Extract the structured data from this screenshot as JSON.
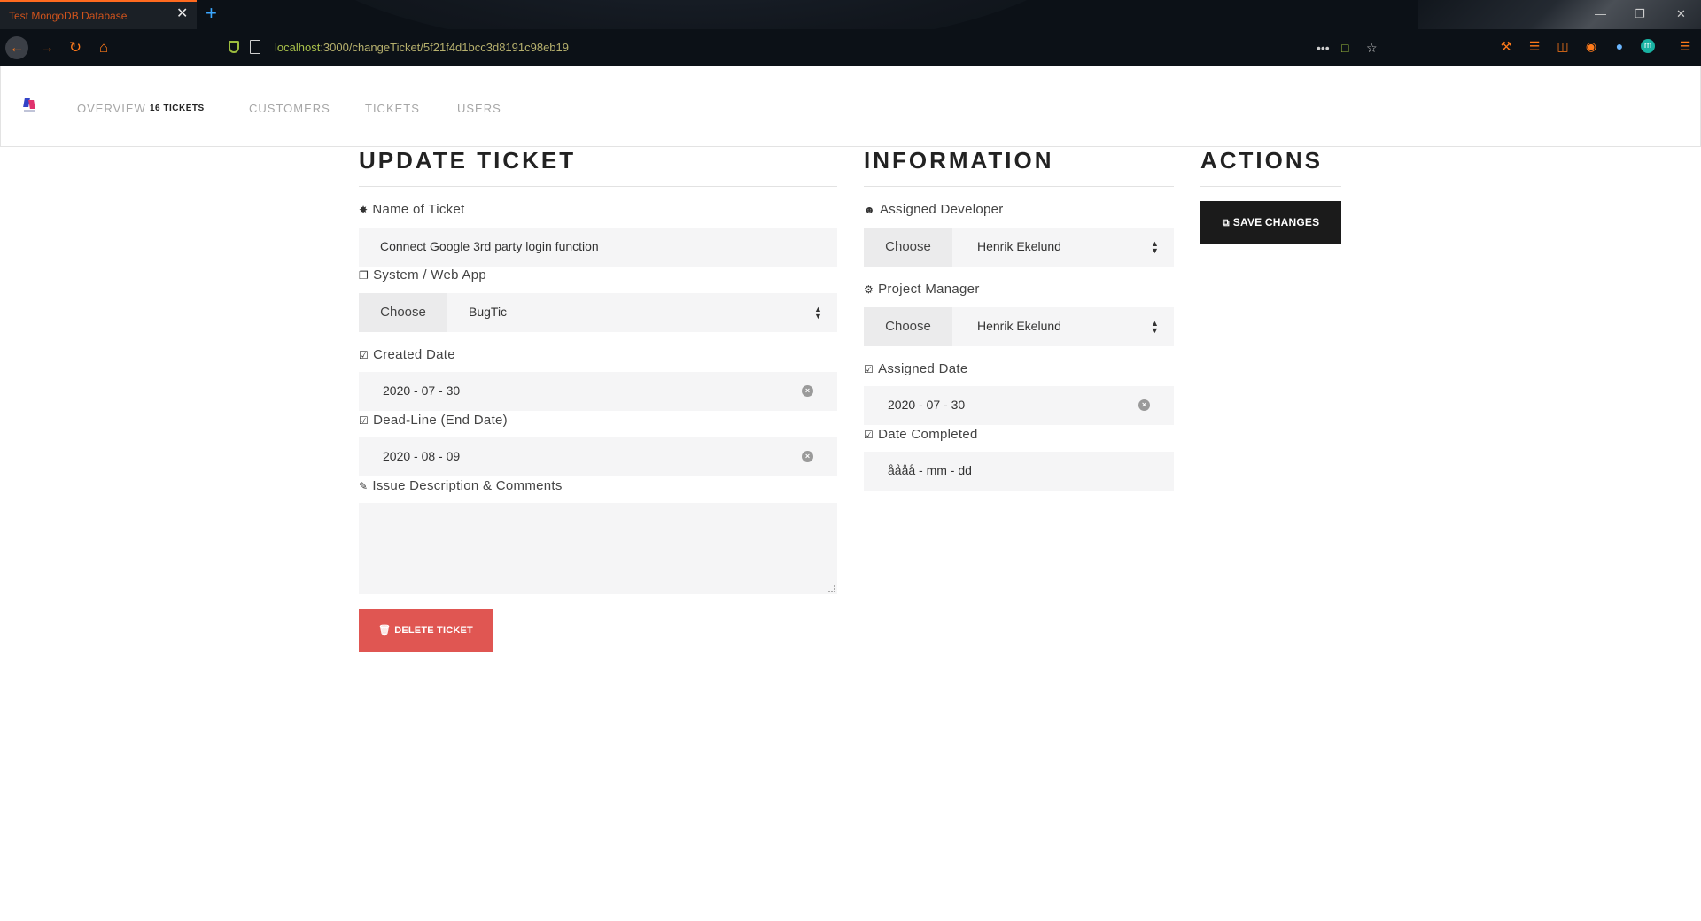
{
  "browser": {
    "tab_title": "Test MongoDB Database",
    "tab_close": "✕",
    "new_tab": "+",
    "url_host": "localhost",
    "url_path": ":3000/changeTicket/5f21f4d1bcc3d8191c98eb19",
    "more": "•••",
    "window_controls": [
      "—",
      "❐",
      "✕"
    ]
  },
  "header": {
    "nav": [
      {
        "label": "OVERVIEW",
        "count": "16 TICKETS"
      },
      {
        "label": "CUSTOMERS"
      },
      {
        "label": "TICKETS"
      },
      {
        "label": "USERS"
      }
    ]
  },
  "update": {
    "title": "UPDATE TICKET",
    "name_label": "Name of Ticket",
    "name_value": "Connect Google 3rd party login function",
    "system_label": "System / Web App",
    "system_choose": "Choose",
    "system_value": "BugTic",
    "created_label": "Created Date",
    "created_value": "2020 - 07 - 30",
    "deadline_label": "Dead-Line (End Date)",
    "deadline_value": "2020 - 08 - 09",
    "description_label": "Issue Description & Comments",
    "description_value": "",
    "delete_label": "DELETE TICKET"
  },
  "info": {
    "title": "INFORMATION",
    "developer_label": "Assigned Developer",
    "developer_choose": "Choose",
    "developer_value": "Henrik Ekelund",
    "manager_label": "Project Manager",
    "manager_choose": "Choose",
    "manager_value": "Henrik Ekelund",
    "assigned_date_label": "Assigned Date",
    "assigned_date_value": "2020 - 07 - 30",
    "completed_label": "Date Completed",
    "completed_value": "åååå - mm - dd"
  },
  "actions": {
    "title": "ACTIONS",
    "save_label": "SAVE CHANGES"
  },
  "colors": {
    "accent_orange": "#ff7a1a",
    "delete_red": "#e05652",
    "save_dark": "#1b1b1b"
  }
}
